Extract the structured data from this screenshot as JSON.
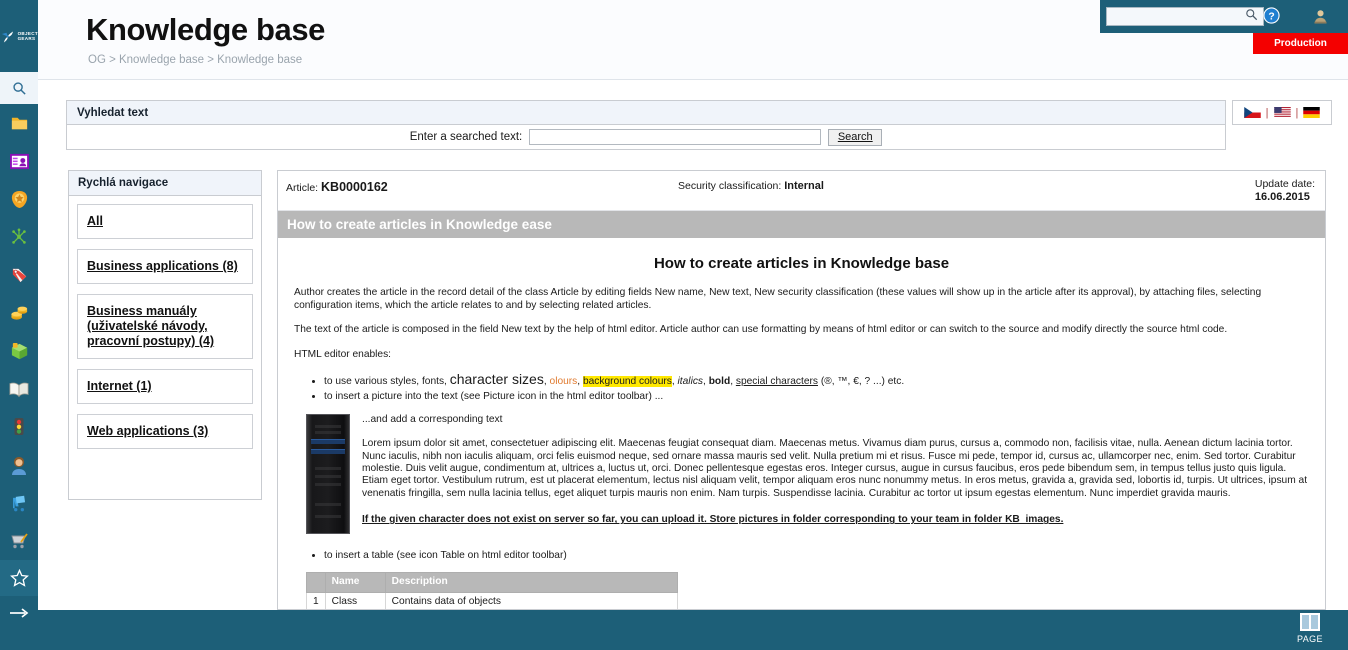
{
  "brand": {
    "logo_text_line1": "OBJECT",
    "logo_text_line2": "GEARS"
  },
  "header": {
    "title": "Knowledge base",
    "breadcrumb": "OG > Knowledge base > Knowledge base",
    "top_search_placeholder": "",
    "top_search_value": "",
    "env_badge": "Production",
    "icons": [
      "search-icon",
      "help-icon",
      "user-icon"
    ]
  },
  "search_panel": {
    "title": "Vyhledat text",
    "label": "Enter a searched text:",
    "input_value": "",
    "button": "Search"
  },
  "languages": [
    {
      "name": "czech-flag",
      "code": "CZ"
    },
    {
      "name": "usa-flag",
      "code": "EN"
    },
    {
      "name": "german-flag",
      "code": "DE"
    }
  ],
  "quick_nav": {
    "title": "Rychlá navigace",
    "items": [
      {
        "label": "All",
        "tall": false
      },
      {
        "label": "Business applications (8)",
        "tall": false
      },
      {
        "label": "Business manuály (uživatelské návody, pracovní postupy) (4)",
        "tall": true
      },
      {
        "label": "Internet (1)",
        "tall": false
      },
      {
        "label": "Web applications (3)",
        "tall": false
      }
    ]
  },
  "article": {
    "meta": {
      "article_label": "Article:",
      "article_id": "KB0000162",
      "security_label": "Security classification:",
      "security_value": "Internal",
      "update_label": "Update date:",
      "update_value": "16.06.2015"
    },
    "band_title": "How to create articles in Knowledge ease",
    "heading": "How to create articles in  Knowledge base",
    "paragraph1": "Author creates the article in the record detail of the class Article by editing fields New name, New text, New security classification (these values will show up in the article after its approval), by attaching files, selecting configuration items, which the article relates to and by selecting related articles.",
    "paragraph2": "The text of the article is composed in the field New text by the help of html editor. Article author can use formatting by means of  html editor or can switch to the source and modify directly the source html code.",
    "paragraph3": "HTML editor enables:",
    "bullet1": {
      "lead": "to use various styles, fonts, ",
      "big": "character sizes",
      "sep1": ", ",
      "orange": "olours",
      "sep2": ", ",
      "highlight": "background colours",
      "sep3": ", ",
      "italic": "italics",
      "sep4": ", ",
      "bold": "bold",
      "sep5": ", ",
      "underline": "special characters",
      "tail": " (®, ™, €, ? ...) etc."
    },
    "bullet2": "to insert a picture into the text (see Picture icon in the html editor toolbar) ...",
    "figure_caption": "...and add a corresponding text",
    "lorem": "Lorem ipsum dolor sit amet, consectetuer adipiscing elit. Maecenas feugiat consequat diam. Maecenas metus. Vivamus diam purus, cursus a, commodo non, facilisis vitae, nulla. Aenean dictum lacinia tortor. Nunc iaculis, nibh non iaculis aliquam, orci felis euismod neque, sed ornare massa mauris sed velit. Nulla pretium mi et risus. Fusce mi pede, tempor id, cursus ac, ullamcorper nec, enim. Sed tortor. Curabitur molestie. Duis velit augue, condimentum at, ultrices a, luctus ut, orci. Donec pellentesque egestas eros. Integer cursus, augue in cursus faucibus, eros pede bibendum sem, in tempus tellus justo quis ligula. Etiam eget tortor. Vestibulum rutrum, est ut placerat elementum, lectus nisl aliquam velit, tempor aliquam eros nunc nonummy metus. In eros metus, gravida a, gravida sed, lobortis id, turpis. Ut ultrices, ipsum at venenatis fringilla, sem nulla lacinia tellus, eget aliquet turpis mauris non enim. Nam turpis. Suspendisse lacinia. Curabitur ac tortor ut ipsum egestas elementum. Nunc imperdiet gravida mauris.",
    "figure_note": "If the given character does not exist on server so far, you can upload it. Store pictures in folder corresponding to your team in folder KB_images.",
    "bullet3": "to insert a table (see icon Table on html editor toolbar)",
    "table": {
      "columns": [
        "",
        "Name",
        "Description"
      ],
      "rows": [
        [
          "1",
          "Class",
          "Contains data of objects"
        ]
      ]
    }
  },
  "rail": {
    "items": [
      {
        "name": "search-icon",
        "selected": false
      },
      {
        "name": "folder-icon",
        "selected": false
      },
      {
        "name": "id-card-icon",
        "selected": false
      },
      {
        "name": "badge-icon",
        "selected": false
      },
      {
        "name": "network-icon",
        "selected": false
      },
      {
        "name": "tag-icon",
        "selected": false
      },
      {
        "name": "coins-icon",
        "selected": false
      },
      {
        "name": "package-icon",
        "selected": false
      },
      {
        "name": "book-icon",
        "selected": false
      },
      {
        "name": "traffic-light-icon",
        "selected": false
      },
      {
        "name": "person-icon",
        "selected": false
      },
      {
        "name": "cart-blue-icon",
        "selected": false
      },
      {
        "name": "shopping-cart-icon",
        "selected": false
      },
      {
        "name": "star-icon",
        "selected": true
      },
      {
        "name": "arrow-right-icon",
        "selected": false
      }
    ]
  },
  "footer": {
    "page_label": "PAGE"
  },
  "colors": {
    "brand_teal": "#1d5f78",
    "env_red": "#f40000",
    "band_gray": "#b8b8b8",
    "highlight_yellow": "#ffe800",
    "orange_text": "#e07a2f"
  }
}
